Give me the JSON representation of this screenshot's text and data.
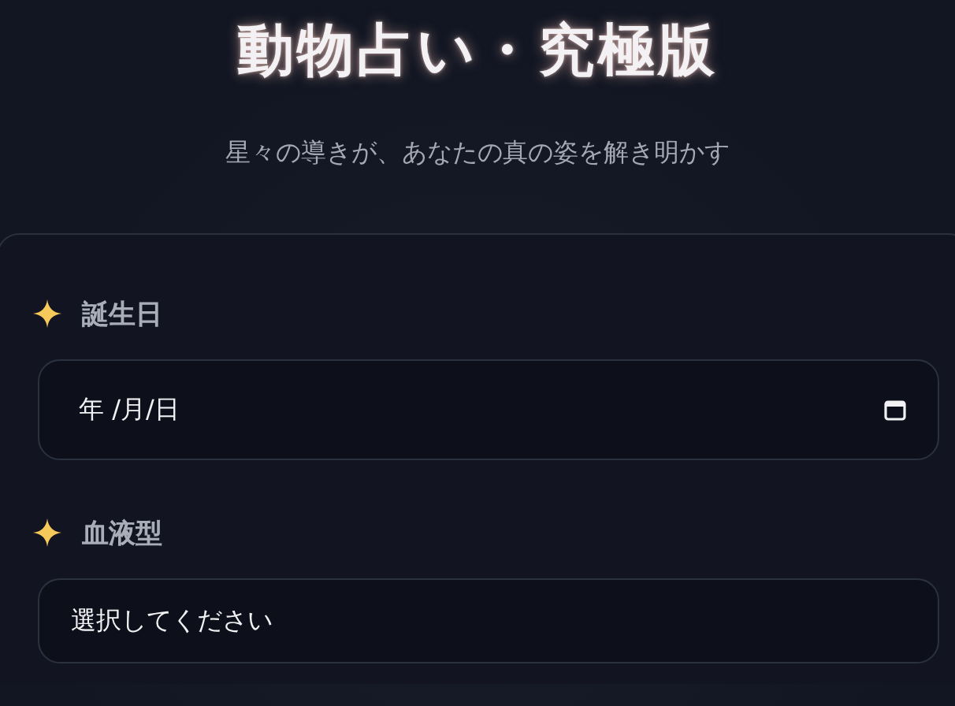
{
  "header": {
    "title": "動物占い・究極版",
    "subtitle": "星々の導きが、あなたの真の姿を解き明かす"
  },
  "form": {
    "fields": [
      {
        "kind": "date",
        "label": "誕生日",
        "value": "年 /月/日"
      },
      {
        "kind": "select",
        "label": "血液型",
        "value": "選択してください"
      }
    ]
  }
}
